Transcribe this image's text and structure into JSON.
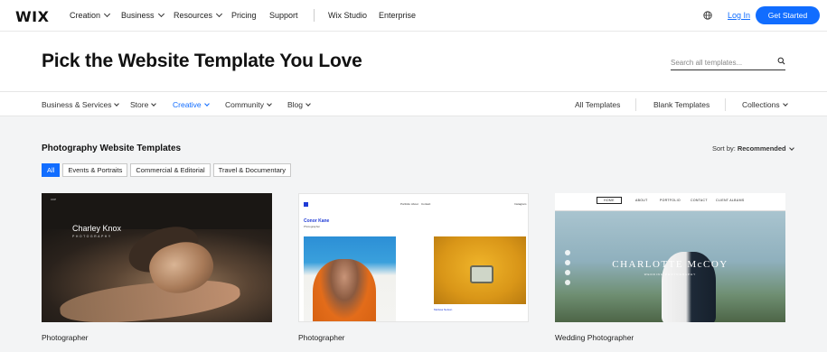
{
  "topnav": {
    "logo": "WIX",
    "items": [
      {
        "label": "Creation",
        "dropdown": true
      },
      {
        "label": "Business",
        "dropdown": true
      },
      {
        "label": "Resources",
        "dropdown": true
      },
      {
        "label": "Pricing",
        "dropdown": false
      },
      {
        "label": "Support",
        "dropdown": false
      },
      {
        "label": "Wix Studio",
        "dropdown": false
      },
      {
        "label": "Enterprise",
        "dropdown": false
      }
    ],
    "globe_icon": "globe-icon",
    "login": "Log In",
    "get_started": "Get Started"
  },
  "hero": {
    "title": "Pick the Website Template You Love",
    "search_placeholder": "Search all templates...",
    "search_icon": "search-icon"
  },
  "categories": {
    "left": [
      {
        "label": "Business & Services",
        "active": false
      },
      {
        "label": "Store",
        "active": false
      },
      {
        "label": "Creative",
        "active": true
      },
      {
        "label": "Community",
        "active": false
      },
      {
        "label": "Blog",
        "active": false
      }
    ],
    "right": [
      "All Templates",
      "Blank Templates",
      "Collections"
    ]
  },
  "section": {
    "title": "Photography Website Templates",
    "sort_label": "Sort by:",
    "sort_value": "Recommended",
    "filters": [
      {
        "label": "All",
        "active": true
      },
      {
        "label": "Events & Portraits",
        "active": false
      },
      {
        "label": "Commercial & Editorial",
        "active": false
      },
      {
        "label": "Travel & Documentary",
        "active": false
      }
    ]
  },
  "templates": [
    {
      "label": "Photographer",
      "preview": {
        "name": "Charley Knox",
        "subtitle": "PHOTOGRAPHY",
        "brand": "CKP"
      }
    },
    {
      "label": "Photographer",
      "preview": {
        "name": "Conor Kane",
        "subtitle": "Photographer",
        "menu": [
          "Portfolio",
          "About",
          "Contact"
        ],
        "instagram": "Instagram",
        "caption": "Melissa Nelson"
      }
    },
    {
      "label": "Wedding Photographer",
      "preview": {
        "menu": [
          "HOME",
          "ABOUT",
          "PORTFOLIO",
          "CONTACT",
          "CLIENT ALBUMS"
        ],
        "title": "CHARLOTTE McCOY",
        "subtitle": "WEDDING PHOTOGRAPHY"
      }
    }
  ],
  "colors": {
    "accent": "#116dff",
    "background": "#f3f4f5"
  }
}
